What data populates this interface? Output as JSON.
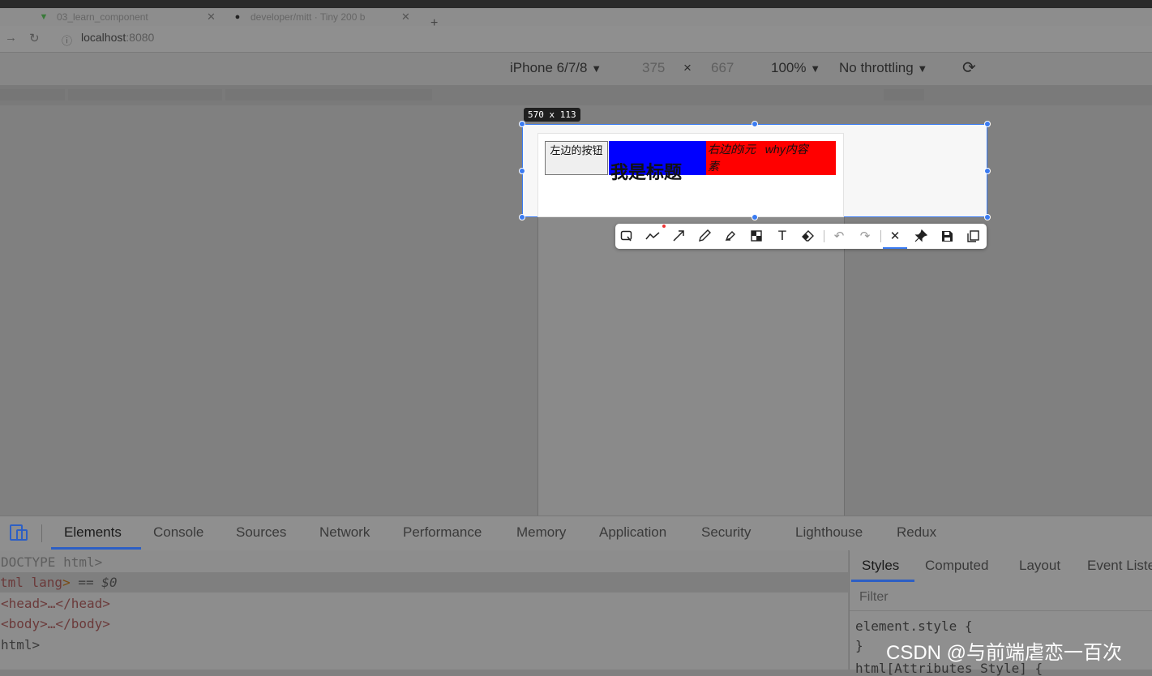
{
  "browser": {
    "tabs": [
      {
        "title": "03_learn_component"
      },
      {
        "title": "developer/mitt · Tiny 200 b"
      }
    ],
    "url": {
      "host": "localhost",
      "port": ":8080"
    }
  },
  "device_toolbar": {
    "device": "iPhone 6/7/8",
    "width": "375",
    "times": "×",
    "height": "667",
    "zoom": "100%",
    "throttling": "No throttling",
    "dropdown_arrow": "▼"
  },
  "screenshot_overlay": {
    "size_badge": "570 x 113"
  },
  "page": {
    "left_button": "左边的按钮",
    "title": "我是标题",
    "right_text_1": "右边的i元",
    "right_text_2": "why内容",
    "right_text_3": "素"
  },
  "annotation_toolbar": {
    "tools": [
      "rect-icon",
      "line-icon",
      "arrow-icon",
      "pencil-icon",
      "marker-icon",
      "mosaic-icon",
      "text-icon",
      "eraser-icon",
      "undo-icon",
      "redo-icon",
      "close-icon",
      "pin-icon",
      "save-icon",
      "copy-icon"
    ]
  },
  "devtools": {
    "tabs": [
      "Elements",
      "Console",
      "Sources",
      "Network",
      "Performance",
      "Memory",
      "Application",
      "Security",
      "Lighthouse",
      "Redux"
    ],
    "active_tab": "Elements",
    "dom_lines": {
      "doctype": "DOCTYPE html>",
      "html_open_tag": "tml lang",
      "html_open_gt": ">",
      "selected_marker": " == $0",
      "head": "<head>…</head>",
      "body": "<body>…</body>",
      "html_close": "html>"
    },
    "styles_tabs": [
      "Styles",
      "Computed",
      "Layout",
      "Event Liste"
    ],
    "filter_placeholder": "Filter",
    "element_style_open": "element.style {",
    "element_style_close": "}",
    "next_rule": "html[Attributes Style] {"
  },
  "watermark": "CSDN @与前端虐恋一百次"
}
